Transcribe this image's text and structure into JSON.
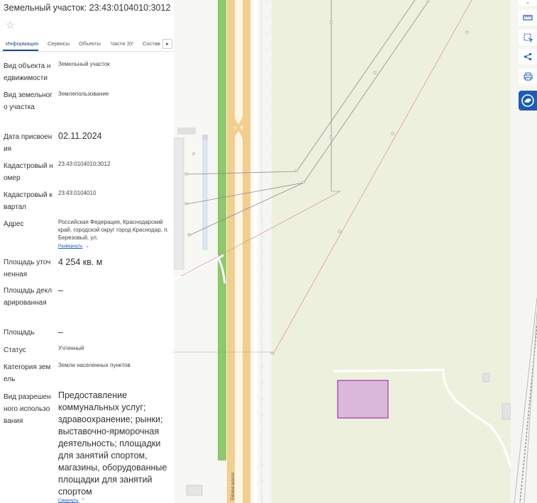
{
  "header": {
    "title": "Земельный участок: 23:43:0104010:3012"
  },
  "tabs": [
    {
      "label": "Информация",
      "active": true
    },
    {
      "label": "Сервисы"
    },
    {
      "label": "Объекты"
    },
    {
      "label": "Части ЗУ"
    },
    {
      "label": "Состав"
    }
  ],
  "info": {
    "object_type": {
      "label": "Вид объекта недвижимости",
      "value": "Земельный участок"
    },
    "land_type": {
      "label": "Вид земельного участка",
      "value": "Землепользование"
    },
    "assigned_date": {
      "label": "Дата присвоения",
      "value": "02.11.2024"
    },
    "cadastral_number": {
      "label": "Кадастровый номер",
      "value": "23:43:0104010:3012"
    },
    "cadastral_quarter": {
      "label": "Кадастровый квартал",
      "value": "23:43:0104010"
    },
    "address": {
      "label": "Адрес",
      "value": "Российская Федерация, Краснодарский край, городской округ город Краснодар, п. Березовый, ул.",
      "expand_label": "Развернуть"
    },
    "area_specified": {
      "label": "Площадь уточненная",
      "value": "4 254 кв. м"
    },
    "area_declared": {
      "label": "Площадь декларированная",
      "value": "–"
    },
    "area": {
      "label": "Площадь",
      "value": "–"
    },
    "status": {
      "label": "Статус",
      "value": "Учтенный"
    },
    "land_category": {
      "label": "Категория земель",
      "value": "Земли населенных пунктов"
    },
    "permitted_use": {
      "label": "Вид разрешенного использования",
      "value": "Предоставление коммунальных услуг; здравоохранение; рынки; выставочно-ярморочная деятельность; площадки для занятий спортом, магазины, оборудованные площадки для занятий спортом",
      "collapse_label": "Свернуть"
    }
  },
  "map": {
    "parking_label": "P",
    "road_label": "Ейское шоссе",
    "colors": {
      "background": "#f3f3ef",
      "zone": "#eef0de",
      "road": "#f2cf8c",
      "grass": "#8dc86b",
      "parcel_fill": "#dab8dc",
      "parcel_stroke": "#a338a3",
      "cadastral_line": "#8d8d8d",
      "boundary_line": "#d99a9a"
    }
  },
  "toolbar": {
    "colors": {
      "accent": "#1d5bb5"
    }
  }
}
